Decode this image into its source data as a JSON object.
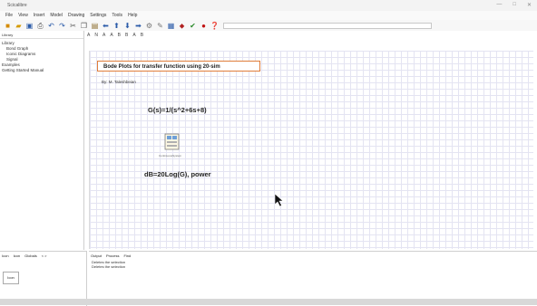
{
  "app": {
    "title": "Scicalibre"
  },
  "window": {
    "controls": [
      "—",
      "□",
      "✕"
    ]
  },
  "menu": [
    "File",
    "View",
    "Insert",
    "Model",
    "Drawing",
    "Settings",
    "Tools",
    "Help"
  ],
  "toolbar": {
    "icons": [
      "new-icon",
      "open-icon",
      "save-icon",
      "print-icon",
      "undo-icon",
      "redo-icon",
      "cut-icon",
      "copy-icon",
      "paste-icon",
      "back-icon",
      "up-icon",
      "down-icon",
      "forward-icon",
      "gear-icon",
      "tools-icon",
      "calc-icon",
      "info-icon",
      "check-icon",
      "record-icon",
      "help-icon"
    ],
    "search_value": ""
  },
  "sidebar": {
    "tabs": [
      "Library"
    ],
    "tree": [
      {
        "label": "Library",
        "level": 0
      },
      {
        "label": "Bond Graph",
        "level": 1
      },
      {
        "label": "Iconic Diagrams",
        "level": 1
      },
      {
        "label": "Signal",
        "level": 1
      },
      {
        "label": "Examples",
        "level": 0
      },
      {
        "label": "Getting Started Manual",
        "level": 0
      }
    ]
  },
  "canvas_toolbar": [
    "A",
    "N",
    "A",
    "A",
    "B",
    "B",
    "A",
    "B"
  ],
  "canvas": {
    "doc_title": "Bode Plots for transfer function using 20-sim",
    "author": "By: M. Taleshbeian",
    "equation": "G(s)=1/(s^2+6s+8)",
    "block_label": "ContinuousSystem",
    "db_text": "dB=20Log(G), power"
  },
  "bottom_left": {
    "tabs": [
      "Icon",
      "Icon",
      "Globals",
      "< >"
    ],
    "field": "Icon"
  },
  "bottom_right": {
    "tabs": [
      "Output",
      "Process",
      "Find"
    ],
    "log": [
      "Deletes the selection",
      "Deletes the selection"
    ]
  },
  "colors": {
    "title_border": "#e07d3a",
    "grid": "#e4e4f2"
  }
}
